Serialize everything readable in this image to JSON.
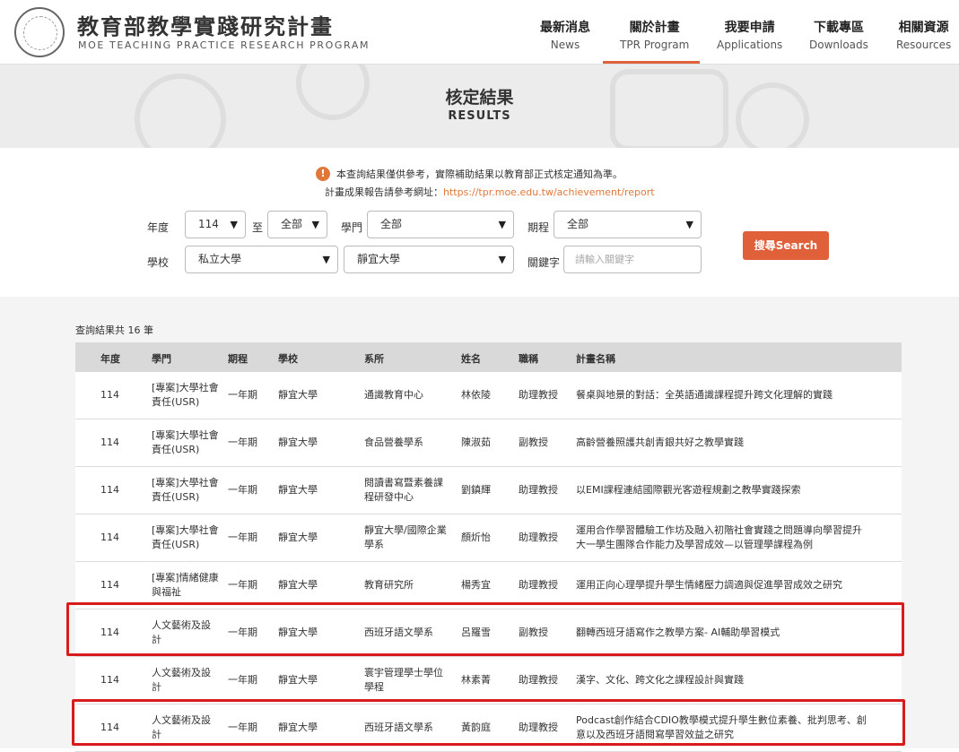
{
  "brand": {
    "title": "教育部教學實踐研究計畫",
    "subtitle": "MOE TEACHING PRACTICE RESEARCH PROGRAM"
  },
  "nav": [
    {
      "zh": "最新消息",
      "en": "News"
    },
    {
      "zh": "關於計畫",
      "en": "TPR Program"
    },
    {
      "zh": "我要申請",
      "en": "Applications"
    },
    {
      "zh": "下載專區",
      "en": "Downloads"
    },
    {
      "zh": "相關資源",
      "en": "Resources"
    }
  ],
  "banner": {
    "title": "核定結果",
    "subtitle": "RESULTS"
  },
  "notice": {
    "line1": "本查詢結果僅供參考，實際補助結果以教育部正式核定通知為準。",
    "line2_prefix": "計畫成果報告請參考網址：",
    "line2_link": "https://tpr.moe.edu.tw/achievement/report"
  },
  "filters": {
    "year_label": "年度",
    "year_value": "114",
    "to_label": "至",
    "to_value": "全部",
    "field_label": "學門",
    "field_value": "全部",
    "term_label": "期程",
    "term_value": "全部",
    "school_label": "學校",
    "school_type_value": "私立大學",
    "school_value": "靜宜大學",
    "keyword_label": "關鍵字",
    "keyword_placeholder": "請輸入關鍵字",
    "search_button": "搜尋Search"
  },
  "results": {
    "count_text": "查詢結果共 16 筆",
    "headers": [
      "年度",
      "學門",
      "期程",
      "學校",
      "系所",
      "姓名",
      "職稱",
      "計畫名稱"
    ],
    "rows": [
      {
        "year": "114",
        "field": [
          "[專案]大學社會",
          "責任(USR)"
        ],
        "term": "一年期",
        "school": "靜宜大學",
        "dept": [
          "通識教育中心"
        ],
        "name": "林依陵",
        "title": "助理教授",
        "plan": [
          "餐桌與地景的對話：全英語通識課程提升跨文化理解的實踐"
        ]
      },
      {
        "year": "114",
        "field": [
          "[專案]大學社會",
          "責任(USR)"
        ],
        "term": "一年期",
        "school": "靜宜大學",
        "dept": [
          "食品營養學系"
        ],
        "name": "陳淑茹",
        "title": "副教授",
        "plan": [
          "高齡營養照護共創青銀共好之教學實踐"
        ]
      },
      {
        "year": "114",
        "field": [
          "[專案]大學社會",
          "責任(USR)"
        ],
        "term": "一年期",
        "school": "靜宜大學",
        "dept": [
          "閱讀書寫暨素養課",
          "程研發中心"
        ],
        "name": "劉鎮輝",
        "title": "助理教授",
        "plan": [
          "以EMI課程連結國際觀光客遊程規劃之教學實踐探索"
        ]
      },
      {
        "year": "114",
        "field": [
          "[專案]大學社會",
          "責任(USR)"
        ],
        "term": "一年期",
        "school": "靜宜大學",
        "dept": [
          "靜宜大學/國際企業",
          "學系"
        ],
        "name": "顏炘怡",
        "title": "助理教授",
        "plan": [
          "運用合作學習體驗工作坊及融入初階社會實踐之問題導向學習提升",
          "大一學生團隊合作能力及學習成效—以管理學課程為例"
        ]
      },
      {
        "year": "114",
        "field": [
          "[專案]情緒健康",
          "與福祉"
        ],
        "term": "一年期",
        "school": "靜宜大學",
        "dept": [
          "教育研究所"
        ],
        "name": "楊秀宜",
        "title": "助理教授",
        "plan": [
          "運用正向心理學提升學生情緒壓力調適與促進學習成效之研究"
        ]
      },
      {
        "year": "114",
        "field": [
          "人文藝術及設",
          "計"
        ],
        "term": "一年期",
        "school": "靜宜大學",
        "dept": [
          "西班牙語文學系"
        ],
        "name": "呂羅雪",
        "title": "副教授",
        "plan": [
          "翻轉西班牙語寫作之教學方案- AI輔助學習模式"
        ]
      },
      {
        "year": "114",
        "field": [
          "人文藝術及設",
          "計"
        ],
        "term": "一年期",
        "school": "靜宜大學",
        "dept": [
          "寰宇管理學士學位",
          "學程"
        ],
        "name": "林素菁",
        "title": "助理教授",
        "plan": [
          "漢字、文化、跨文化之課程設計與實踐"
        ]
      },
      {
        "year": "114",
        "field": [
          "人文藝術及設",
          "計"
        ],
        "term": "一年期",
        "school": "靜宜大學",
        "dept": [
          "西班牙語文學系"
        ],
        "name": "黃韵庭",
        "title": "助理教授",
        "plan": [
          "Podcast創作結合CDIO教學模式提升學生數位素養、批判思考、創",
          "意以及西班牙語閱寫學習效益之研究"
        ]
      }
    ]
  },
  "colors": {
    "accent": "#e0603a",
    "highlight": "#d81b1b",
    "banner_bg": "#ececec"
  }
}
